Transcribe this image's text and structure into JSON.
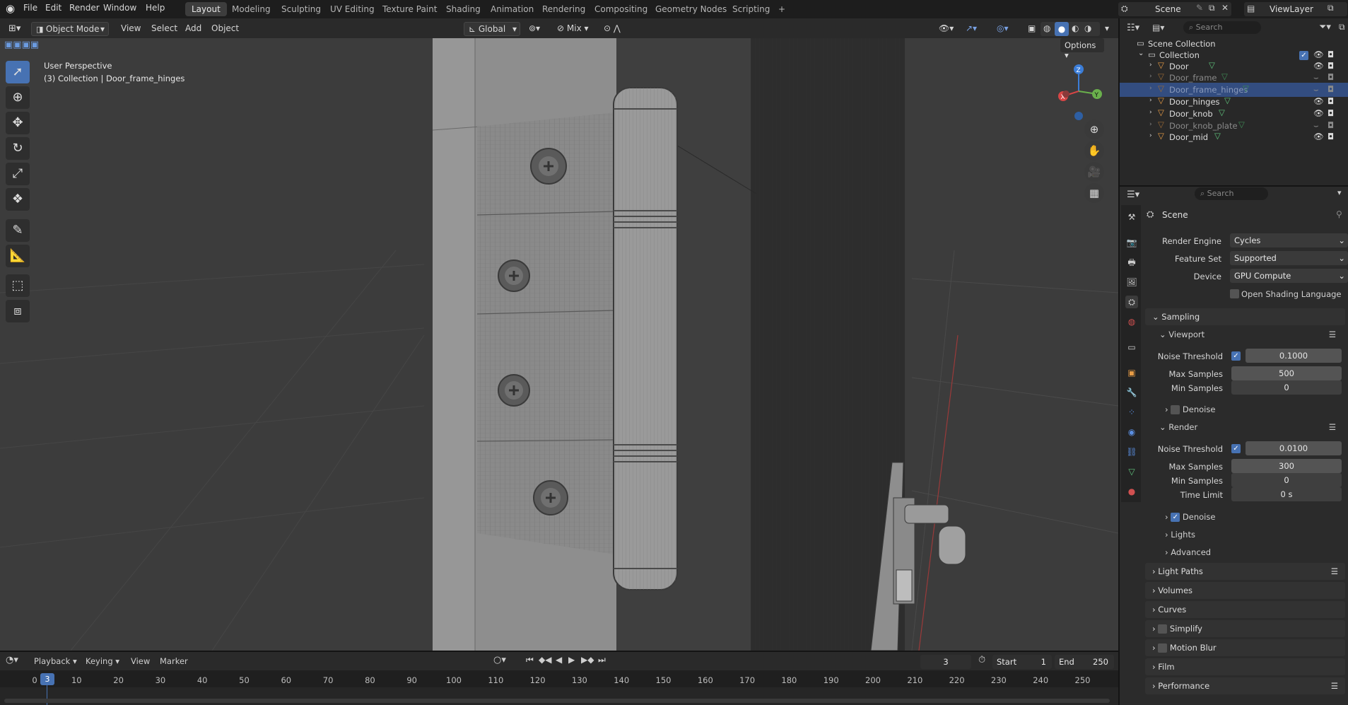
{
  "top_menu": {
    "items": [
      "File",
      "Edit",
      "Render",
      "Window",
      "Help"
    ],
    "workspaces": [
      "Layout",
      "Modeling",
      "Sculpting",
      "UV Editing",
      "Texture Paint",
      "Shading",
      "Animation",
      "Rendering",
      "Compositing",
      "Geometry Nodes",
      "Scripting"
    ],
    "active_workspace": "Layout",
    "add_workspace": "+",
    "scene": "Scene",
    "view_layer": "ViewLayer"
  },
  "viewport_header": {
    "mode": "Object Mode",
    "menus": [
      "View",
      "Select",
      "Add",
      "Object"
    ],
    "transform_orientation": "Global",
    "snap_mode": "Mix",
    "options": "Options"
  },
  "viewport": {
    "view_name": "User Perspective",
    "collection_info": "(3) Collection | Door_frame_hinges",
    "gizmo": {
      "z": "Z",
      "y": "Y",
      "x": "X"
    }
  },
  "outliner": {
    "search_placeholder": "Search",
    "root": "Scene Collection",
    "collection": "Collection",
    "objects": [
      {
        "name": "Door",
        "dim": false,
        "selected": false
      },
      {
        "name": "Door_frame",
        "dim": true,
        "selected": false
      },
      {
        "name": "Door_frame_hinges",
        "dim": true,
        "selected": true
      },
      {
        "name": "Door_hinges",
        "dim": false,
        "selected": false
      },
      {
        "name": "Door_knob",
        "dim": false,
        "selected": false
      },
      {
        "name": "Door_knob_plate",
        "dim": true,
        "selected": false
      },
      {
        "name": "Door_mid",
        "dim": false,
        "selected": false
      }
    ]
  },
  "properties": {
    "search_placeholder": "Search",
    "context": "Scene",
    "render_engine_label": "Render Engine",
    "render_engine": "Cycles",
    "feature_set_label": "Feature Set",
    "feature_set": "Supported",
    "device_label": "Device",
    "device": "GPU Compute",
    "osl_label": "Open Shading Language",
    "sampling": "Sampling",
    "viewport": "Viewport",
    "vp_noise_label": "Noise Threshold",
    "vp_noise": "0.1000",
    "vp_max_label": "Max Samples",
    "vp_max": "500",
    "vp_min_label": "Min Samples",
    "vp_min": "0",
    "vp_denoise": "Denoise",
    "render": "Render",
    "r_noise_label": "Noise Threshold",
    "r_noise": "0.0100",
    "r_max_label": "Max Samples",
    "r_max": "300",
    "r_min_label": "Min Samples",
    "r_min": "0",
    "r_time_label": "Time Limit",
    "r_time": "0 s",
    "r_denoise": "Denoise",
    "lights": "Lights",
    "advanced": "Advanced",
    "panels": [
      "Light Paths",
      "Volumes",
      "Curves",
      "Simplify",
      "Motion Blur",
      "Film",
      "Performance"
    ]
  },
  "timeline": {
    "menus": [
      "Playback",
      "Keying",
      "View",
      "Marker"
    ],
    "current_frame": "3",
    "start_label": "Start",
    "start": "1",
    "end_label": "End",
    "end": "250",
    "ticks": [
      "0",
      "10",
      "20",
      "30",
      "40",
      "50",
      "60",
      "70",
      "80",
      "90",
      "100",
      "110",
      "120",
      "130",
      "140",
      "150",
      "160",
      "170",
      "180",
      "190",
      "200",
      "210",
      "220",
      "230",
      "240",
      "250"
    ]
  }
}
